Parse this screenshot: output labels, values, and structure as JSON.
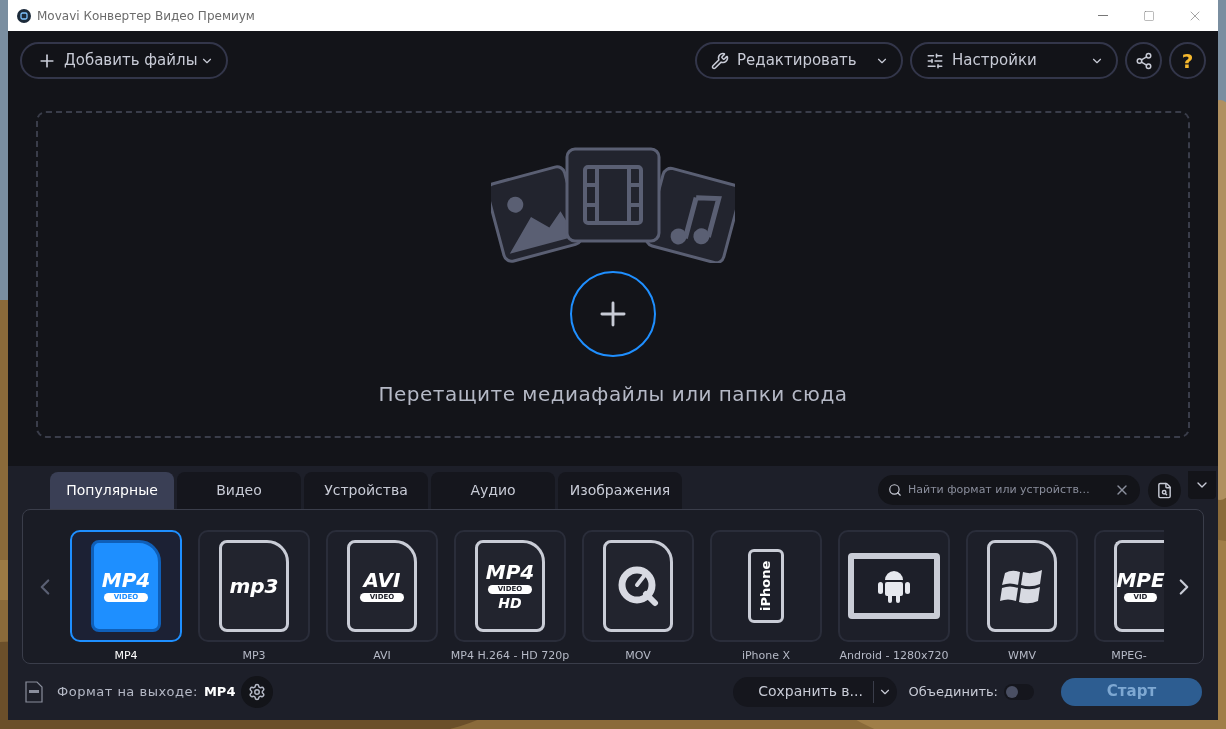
{
  "window": {
    "title": "Movavi Конвертер Видео Премиум"
  },
  "toolbar": {
    "add_files": "Добавить файлы",
    "edit": "Редактировать",
    "settings": "Настройки",
    "help": "?"
  },
  "drop_zone": {
    "text": "Перетащите медиафайлы или папки сюда"
  },
  "tabs": [
    {
      "label": "Популярные",
      "selected": true
    },
    {
      "label": "Видео",
      "selected": false
    },
    {
      "label": "Устройства",
      "selected": false
    },
    {
      "label": "Аудио",
      "selected": false
    },
    {
      "label": "Изображения",
      "selected": false
    }
  ],
  "search": {
    "placeholder": "Найти формат или устройств…"
  },
  "formats": [
    {
      "label": "MP4",
      "kind": "file",
      "icon_text": "MP4",
      "icon_subtext": "VIDEO",
      "selected": true
    },
    {
      "label": "MP3",
      "kind": "file",
      "icon_text": "mp3",
      "selected": false
    },
    {
      "label": "AVI",
      "kind": "file",
      "icon_text": "AVI",
      "icon_subtext": "VIDEO",
      "selected": false
    },
    {
      "label": "MP4 H.264 - HD 720p",
      "kind": "file",
      "icon_text": "MP4",
      "icon_subtext": "VIDEO",
      "icon_extra": "HD",
      "selected": false
    },
    {
      "label": "MOV",
      "kind": "quicktime",
      "selected": false
    },
    {
      "label": "iPhone X",
      "kind": "phone",
      "icon_text": "iPhone",
      "selected": false
    },
    {
      "label": "Android - 1280x720",
      "kind": "tablet",
      "selected": false
    },
    {
      "label": "WMV",
      "kind": "windows",
      "selected": false
    },
    {
      "label": "MPEG-",
      "kind": "file",
      "icon_text": "MPE",
      "icon_subtext": "VID",
      "selected": false
    }
  ],
  "footer": {
    "output_label": "Формат на выходе:",
    "output_value": "MP4",
    "save_to": "Сохранить в...",
    "merge": {
      "label": "Объединить:",
      "on": false
    },
    "start": "Старт"
  }
}
